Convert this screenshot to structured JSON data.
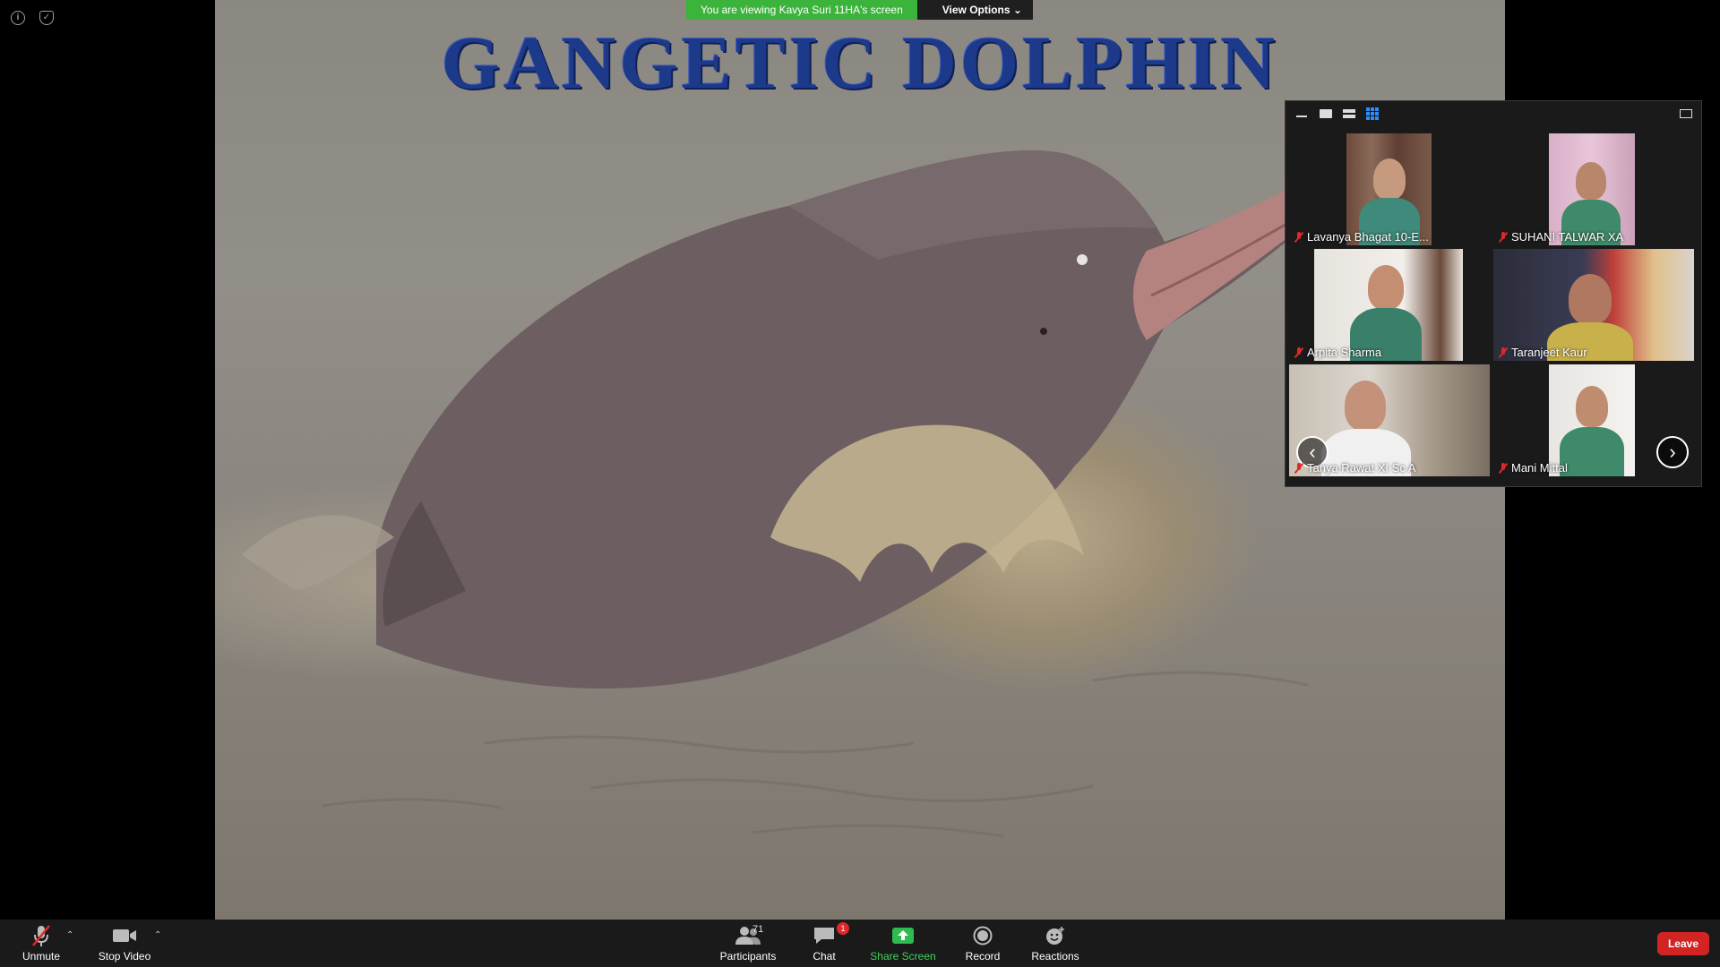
{
  "banner": {
    "message": "You are viewing Kavya Suri 11HA's screen",
    "view_options": "View Options"
  },
  "slide": {
    "title": "GANGETIC DOLPHIN"
  },
  "gallery": {
    "participants": [
      {
        "name": "Lavanya Bhagat 10-E...",
        "muted": true
      },
      {
        "name": "SUHANI TALWAR XA",
        "muted": true
      },
      {
        "name": "Arpita Sharma",
        "muted": true
      },
      {
        "name": "Taranjeet Kaur",
        "muted": true
      },
      {
        "name": "Tanya Rawat XI Sc A",
        "muted": true
      },
      {
        "name": "Mani Mittal",
        "muted": true
      }
    ]
  },
  "toolbar": {
    "unmute": "Unmute",
    "stop_video": "Stop Video",
    "participants": "Participants",
    "participants_count": "71",
    "chat": "Chat",
    "chat_badge": "1",
    "share_screen": "Share Screen",
    "record": "Record",
    "reactions": "Reactions",
    "leave": "Leave"
  },
  "colors": {
    "share_green": "#3cb43c",
    "leave_red": "#d32424",
    "grid_blue": "#2d8cff",
    "title_blue": "#1d3a8a"
  }
}
